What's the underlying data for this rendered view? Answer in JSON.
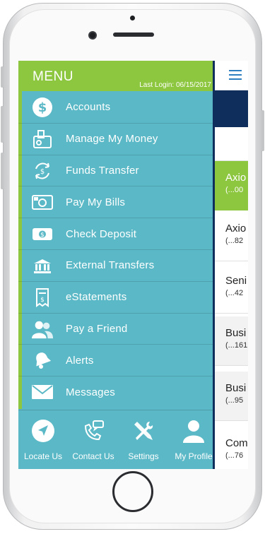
{
  "menu": {
    "title": "MENU",
    "last_login": "Last Login: 06/15/2017",
    "items": [
      {
        "label": "Accounts",
        "icon": "dollar-coin-icon"
      },
      {
        "label": "Manage My Money",
        "icon": "wallet-icon"
      },
      {
        "label": "Funds Transfer",
        "icon": "transfer-arrows-icon"
      },
      {
        "label": "Pay My Bills",
        "icon": "camera-bill-icon"
      },
      {
        "label": "Check Deposit",
        "icon": "check-deposit-icon"
      },
      {
        "label": "External Transfers",
        "icon": "bank-transfer-icon"
      },
      {
        "label": "eStatements",
        "icon": "statement-icon"
      },
      {
        "label": "Pay a Friend",
        "icon": "friends-icon"
      },
      {
        "label": "Alerts",
        "icon": "bell-icon"
      },
      {
        "label": "Messages",
        "icon": "envelope-icon"
      }
    ]
  },
  "bottom_nav": [
    {
      "label": "Locate Us",
      "icon": "location-arrow-icon"
    },
    {
      "label": "Contact Us",
      "icon": "phone-chat-icon"
    },
    {
      "label": "Settings",
      "icon": "tools-icon"
    },
    {
      "label": "My Profile",
      "icon": "person-icon"
    }
  ],
  "background_accounts": [
    {
      "name": "Axio",
      "number": "(...00"
    },
    {
      "name": "Axio",
      "number": "(...82"
    },
    {
      "name": "Seni",
      "number": "(...42"
    },
    {
      "name": "Busi",
      "number": "(...161"
    },
    {
      "name": "Busi",
      "number": "(...95"
    },
    {
      "name": "Com",
      "number": "(...76"
    }
  ],
  "colors": {
    "drawer_teal": "#5bb8c6",
    "header_green": "#8dc63f",
    "navy": "#0f2e5c"
  }
}
